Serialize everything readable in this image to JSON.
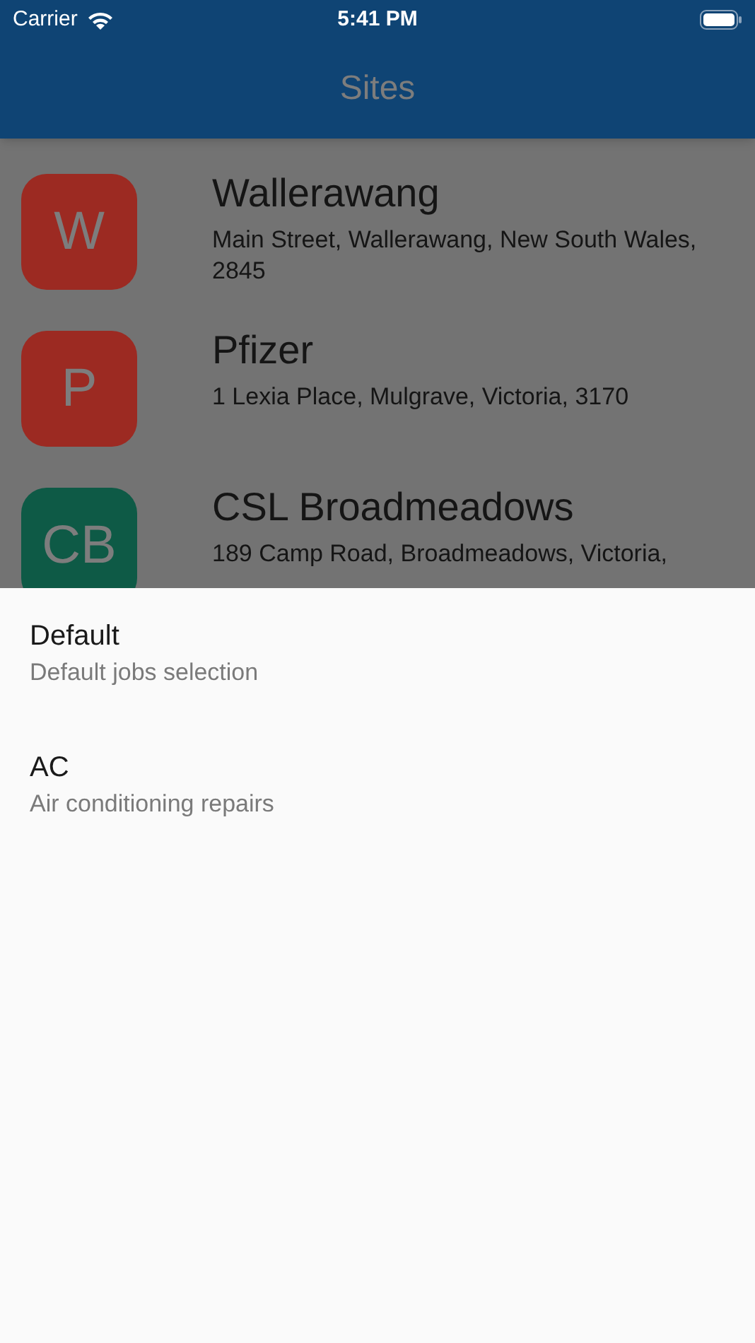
{
  "status_bar": {
    "carrier": "Carrier",
    "time": "5:41 PM"
  },
  "app_bar": {
    "title": "Sites"
  },
  "sites": [
    {
      "initials": "W",
      "color": "#9c2a22",
      "name": "Wallerawang",
      "address": "Main Street, Wallerawang, New South Wales, 2845"
    },
    {
      "initials": "P",
      "color": "#9c2a22",
      "name": "Pfizer",
      "address": "1 Lexia Place, Mulgrave, Victoria, 3170"
    },
    {
      "initials": "CB",
      "color": "#0e5a46",
      "name": "CSL Broadmeadows",
      "address": "189 Camp Road, Broadmeadows, Victoria,"
    }
  ],
  "sheet": {
    "options": [
      {
        "title": "Default",
        "subtitle": "Default jobs selection"
      },
      {
        "title": "AC",
        "subtitle": "Air conditioning repairs"
      }
    ]
  }
}
